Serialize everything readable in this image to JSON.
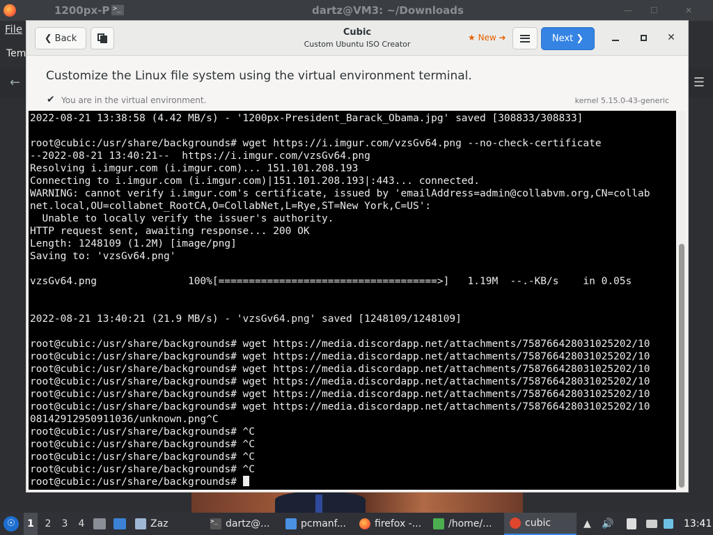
{
  "background": {
    "firefox_tab_title": "1200px-P",
    "window_title": "dartz@VM3: ~/Downloads",
    "menu_file": "File",
    "side_label": "Tem"
  },
  "cubic": {
    "title": "Cubic",
    "subtitle": "Custom Ubuntu ISO Creator",
    "back_label": "Back",
    "new_label": "★ New ➜",
    "next_label": "Next",
    "heading": "Customize the Linux file system using the virtual environment terminal.",
    "status_text": "You are in the virtual environment.",
    "kernel": "kernel 5.15.0-43-generic"
  },
  "terminal": {
    "lines": [
      "2022-08-21 13:38:58 (4.42 MB/s) - '1200px-President_Barack_Obama.jpg' saved [308833/308833]",
      "",
      "root@cubic:/usr/share/backgrounds# wget https://i.imgur.com/vzsGv64.png --no-check-certificate",
      "--2022-08-21 13:40:21--  https://i.imgur.com/vzsGv64.png",
      "Resolving i.imgur.com (i.imgur.com)... 151.101.208.193",
      "Connecting to i.imgur.com (i.imgur.com)|151.101.208.193|:443... connected.",
      "WARNING: cannot verify i.imgur.com's certificate, issued by 'emailAddress=admin@collabvm.org,CN=collab",
      "net.local,OU=collabnet_RootCA,O=CollabNet,L=Rye,ST=New York,C=US':",
      "  Unable to locally verify the issuer's authority.",
      "HTTP request sent, awaiting response... 200 OK",
      "Length: 1248109 (1.2M) [image/png]",
      "Saving to: 'vzsGv64.png'",
      "",
      "vzsGv64.png               100%[====================================>]   1.19M  --.-KB/s    in 0.05s",
      "",
      "",
      "2022-08-21 13:40:21 (21.9 MB/s) - 'vzsGv64.png' saved [1248109/1248109]",
      "",
      "root@cubic:/usr/share/backgrounds# wget https://media.discordapp.net/attachments/758766428031025202/10",
      "root@cubic:/usr/share/backgrounds# wget https://media.discordapp.net/attachments/758766428031025202/10",
      "root@cubic:/usr/share/backgrounds# wget https://media.discordapp.net/attachments/758766428031025202/10",
      "root@cubic:/usr/share/backgrounds# wget https://media.discordapp.net/attachments/758766428031025202/10",
      "root@cubic:/usr/share/backgrounds# wget https://media.discordapp.net/attachments/758766428031025202/10",
      "root@cubic:/usr/share/backgrounds# wget https://media.discordapp.net/attachments/758766428031025202/10",
      "08142912950911036/unknown.png^C",
      "root@cubic:/usr/share/backgrounds# ^C",
      "root@cubic:/usr/share/backgrounds# ^C",
      "root@cubic:/usr/share/backgrounds# ^C",
      "root@cubic:/usr/share/backgrounds# ^C"
    ],
    "prompt": "root@cubic:/usr/share/backgrounds# "
  },
  "taskbar": {
    "workspaces": [
      "1",
      "2",
      "3",
      "4"
    ],
    "tasks": [
      {
        "label": "Zaz",
        "icon": "window-icon"
      },
      {
        "label": "dartz@...",
        "icon": "terminal-icon"
      },
      {
        "label": "pcmanf...",
        "icon": "file-manager-icon"
      },
      {
        "label": "firefox -...",
        "icon": "firefox-icon"
      },
      {
        "label": "/home/...",
        "icon": "editor-icon"
      },
      {
        "label": "cubic",
        "icon": "cubic-icon"
      }
    ],
    "clock": "13:41",
    "colors": {
      "accent": "#3584e4",
      "panel": "#2f3136"
    }
  }
}
